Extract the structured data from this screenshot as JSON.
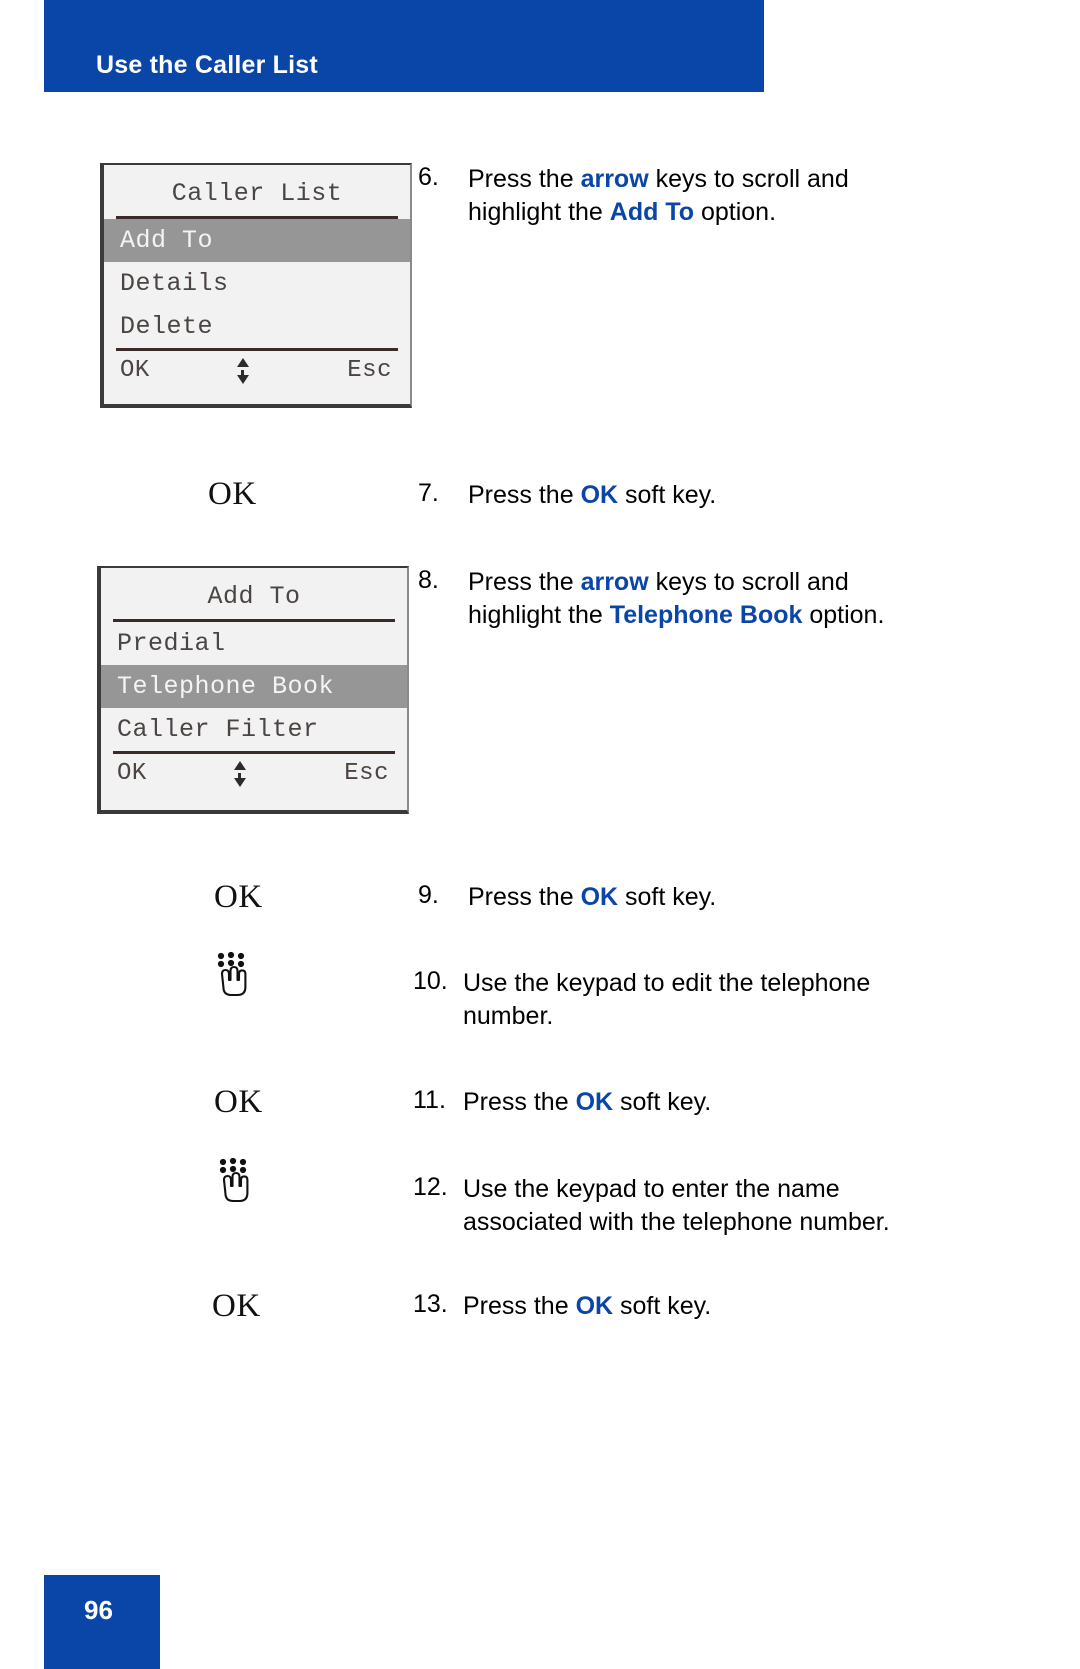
{
  "header": {
    "title": "Use the Caller List",
    "banner_color": "#0A45A8"
  },
  "footer": {
    "page_number": "96"
  },
  "screens": [
    {
      "name": "caller-list-screen",
      "title": "Caller List",
      "items": [
        {
          "label": "Add To",
          "selected": true
        },
        {
          "label": "Details",
          "selected": false
        },
        {
          "label": "Delete",
          "selected": false
        }
      ],
      "softkeys": {
        "left": "OK",
        "right": "Esc"
      }
    },
    {
      "name": "add-to-screen",
      "title": "Add To",
      "items": [
        {
          "label": "Predial",
          "selected": false
        },
        {
          "label": "Telephone Book",
          "selected": true
        },
        {
          "label": "Caller Filter",
          "selected": false
        }
      ],
      "softkeys": {
        "left": "OK",
        "right": "Esc"
      }
    }
  ],
  "steps": [
    {
      "number": "6.",
      "icon": "lcd-screen",
      "parts": [
        {
          "t": "Press the ",
          "hl": false
        },
        {
          "t": "arrow",
          "hl": true
        },
        {
          "t": " keys to scroll and highlight the ",
          "hl": false
        },
        {
          "t": "Add To",
          "hl": true
        },
        {
          "t": " option.",
          "hl": false
        }
      ]
    },
    {
      "number": "7.",
      "icon": "ok-key",
      "icon_label": "OK",
      "parts": [
        {
          "t": "Press the ",
          "hl": false
        },
        {
          "t": "OK",
          "hl": true
        },
        {
          "t": " soft key.",
          "hl": false
        }
      ]
    },
    {
      "number": "8.",
      "icon": "lcd-screen",
      "parts": [
        {
          "t": "Press the ",
          "hl": false
        },
        {
          "t": "arrow",
          "hl": true
        },
        {
          "t": " keys to scroll and highlight the ",
          "hl": false
        },
        {
          "t": "Telephone Book",
          "hl": true
        },
        {
          "t": " option.",
          "hl": false
        }
      ]
    },
    {
      "number": "9.",
      "icon": "ok-key",
      "icon_label": "OK",
      "parts": [
        {
          "t": "Press the ",
          "hl": false
        },
        {
          "t": "OK",
          "hl": true
        },
        {
          "t": " soft key.",
          "hl": false
        }
      ]
    },
    {
      "number": "10.",
      "icon": "keypad-icon",
      "parts": [
        {
          "t": "Use the keypad to edit the telephone number.",
          "hl": false
        }
      ]
    },
    {
      "number": "11.",
      "icon": "ok-key",
      "icon_label": "OK",
      "parts": [
        {
          "t": "Press the ",
          "hl": false
        },
        {
          "t": "OK",
          "hl": true
        },
        {
          "t": " soft key.",
          "hl": false
        }
      ]
    },
    {
      "number": "12.",
      "icon": "keypad-icon",
      "parts": [
        {
          "t": "Use the keypad to enter the name associated with the telephone number.",
          "hl": false
        }
      ]
    },
    {
      "number": "13.",
      "icon": "ok-key",
      "icon_label": "OK",
      "parts": [
        {
          "t": "Press the ",
          "hl": false
        },
        {
          "t": "OK",
          "hl": true
        },
        {
          "t": " soft key.",
          "hl": false
        }
      ]
    }
  ],
  "colors": {
    "brand_blue": "#0A45A8",
    "lcd_bg": "#F2F2F2",
    "lcd_highlight": "#969696",
    "lcd_text": "#4a4442"
  }
}
